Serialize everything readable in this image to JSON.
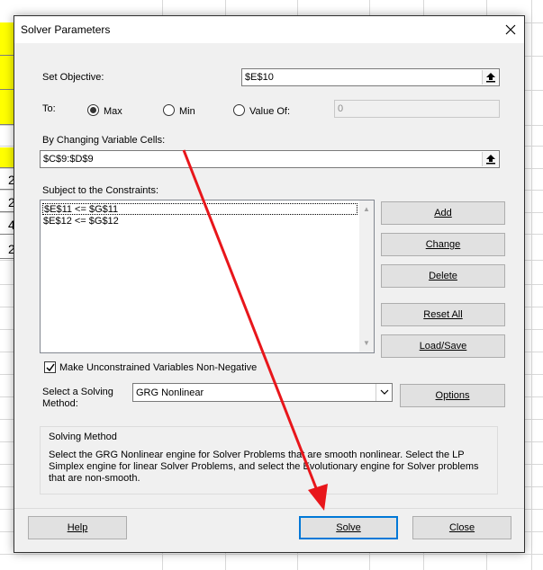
{
  "sheet": {
    "row_numbers": [
      "2",
      "2",
      "4",
      "2"
    ]
  },
  "dialog": {
    "title": "Solver Parameters",
    "set_objective": {
      "label": "Set Objective:",
      "value": "$E$10"
    },
    "to": {
      "label": "To:",
      "options": [
        {
          "label": "Max",
          "selected": true
        },
        {
          "label": "Min",
          "selected": false
        },
        {
          "label": "Value Of:",
          "selected": false
        }
      ],
      "value_of": "0"
    },
    "changing_cells": {
      "label": "By Changing Variable Cells:",
      "value": "$C$9:$D$9"
    },
    "constraints": {
      "label": "Subject to the Constraints:",
      "items": [
        "$E$11 <= $G$11",
        "$E$12 <= $G$12"
      ]
    },
    "buttons": {
      "add": "Add",
      "change": "Change",
      "delete": "Delete",
      "reset_all": "Reset All",
      "load_save": "Load/Save",
      "options": "Options",
      "help": "Help",
      "solve": "Solve",
      "close": "Close"
    },
    "nonnegative": {
      "label": "Make Unconstrained Variables Non-Negative",
      "checked": true
    },
    "solving_method": {
      "label_line1": "Select a Solving",
      "label_line2": "Method:",
      "value": "GRG Nonlinear"
    },
    "method_box": {
      "title": "Solving Method",
      "description": "Select the GRG Nonlinear engine for Solver Problems that are smooth nonlinear. Select the LP Simplex engine for linear Solver Problems, and select the Evolutionary engine for Solver problems that are non-smooth."
    }
  },
  "colors": {
    "accent": "#0078d7",
    "arrow": "#e8161b",
    "highlight": "#ffff00"
  },
  "icons": [
    "close-icon",
    "collapse-dialog-icon",
    "chevron-down-icon",
    "checkmark-icon",
    "arrow-annotation"
  ]
}
